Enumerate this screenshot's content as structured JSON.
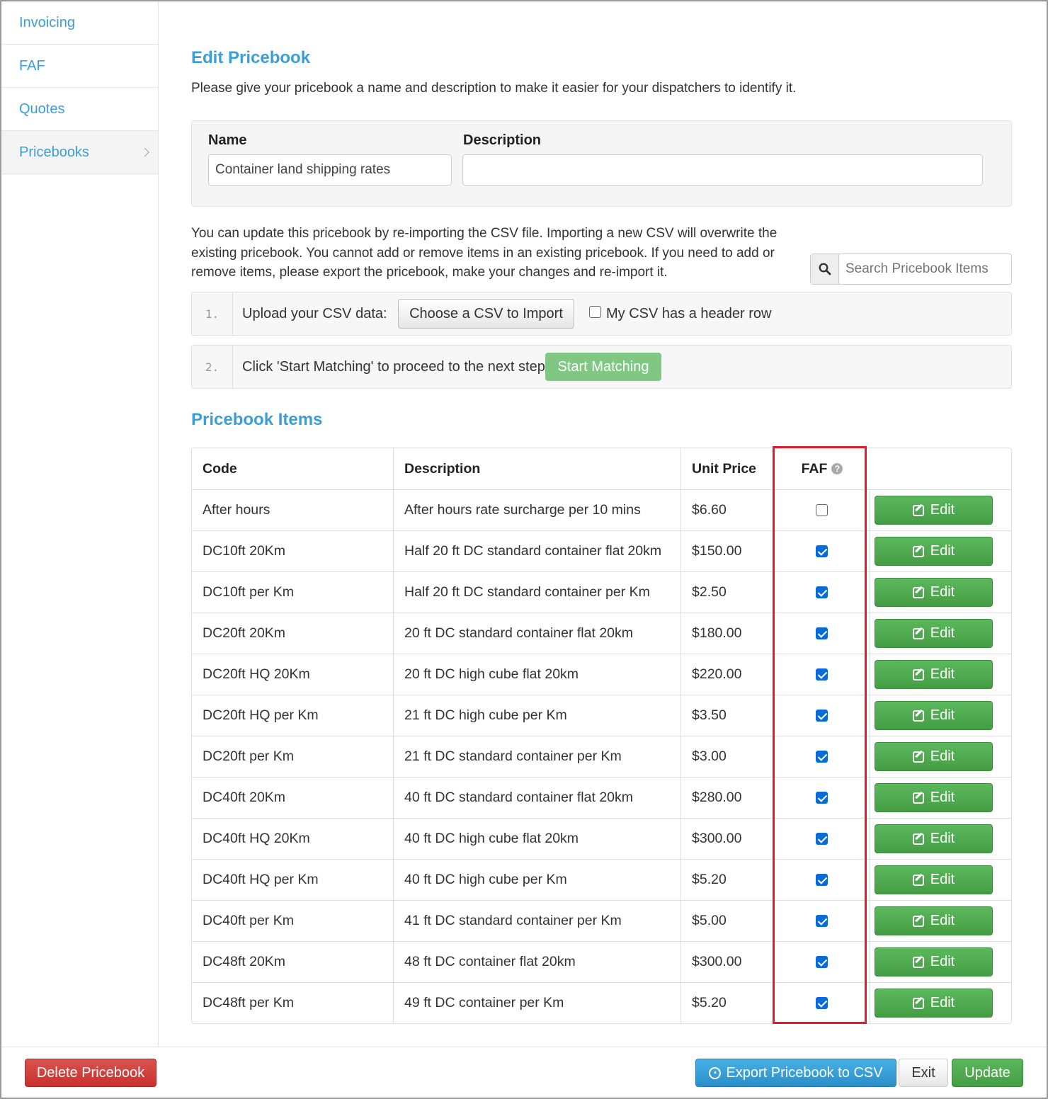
{
  "sidebar": {
    "items": [
      {
        "label": "Invoicing"
      },
      {
        "label": "FAF"
      },
      {
        "label": "Quotes"
      },
      {
        "label": "Pricebooks",
        "active": true
      }
    ]
  },
  "edit": {
    "title": "Edit Pricebook",
    "intro": "Please give your pricebook a name and description to make it easier for your dispatchers to identify it.",
    "name_label": "Name",
    "name_value": "Container land shipping rates",
    "description_label": "Description",
    "description_value": ""
  },
  "import": {
    "info": "You can update this pricebook by re-importing the CSV file. Importing a new CSV will overwrite the existing pricebook. You cannot add or remove items in an existing pricebook. If you need to add or remove items, please export the pricebook, make your changes and re-import it.",
    "search_placeholder": "Search Pricebook Items",
    "step1_num": "1.",
    "step1_text": "Upload your CSV data:",
    "step1_button": "Choose a CSV to Import",
    "header_row_label": "My CSV has a header row",
    "header_row_checked": false,
    "step2_num": "2.",
    "step2_text": "Click 'Start Matching' to proceed to the next step:",
    "step2_button": "Start Matching"
  },
  "items": {
    "title": "Pricebook Items",
    "columns": {
      "code": "Code",
      "description": "Description",
      "unit_price": "Unit Price",
      "faf": "FAF"
    },
    "edit_label": "Edit",
    "rows": [
      {
        "code": "After hours",
        "description": "After hours rate surcharge per 10 mins",
        "price": "$6.60",
        "faf": false
      },
      {
        "code": "DC10ft 20Km",
        "description": "Half 20 ft DC standard container flat 20km",
        "price": "$150.00",
        "faf": true
      },
      {
        "code": "DC10ft per Km",
        "description": "Half 20 ft DC standard container per Km",
        "price": "$2.50",
        "faf": true
      },
      {
        "code": "DC20ft 20Km",
        "description": "20 ft DC standard container flat 20km",
        "price": "$180.00",
        "faf": true
      },
      {
        "code": "DC20ft HQ 20Km",
        "description": "20 ft DC high cube flat 20km",
        "price": "$220.00",
        "faf": true
      },
      {
        "code": "DC20ft HQ per Km",
        "description": "21 ft DC high cube per Km",
        "price": "$3.50",
        "faf": true
      },
      {
        "code": "DC20ft per Km",
        "description": "21 ft DC standard container per Km",
        "price": "$3.00",
        "faf": true
      },
      {
        "code": "DC40ft 20Km",
        "description": "40 ft DC standard container flat 20km",
        "price": "$280.00",
        "faf": true
      },
      {
        "code": "DC40ft HQ 20Km",
        "description": "40 ft DC high cube flat 20km",
        "price": "$300.00",
        "faf": true
      },
      {
        "code": "DC40ft HQ per Km",
        "description": "40 ft DC high cube per Km",
        "price": "$5.20",
        "faf": true
      },
      {
        "code": "DC40ft per Km",
        "description": "41 ft DC standard container per Km",
        "price": "$5.00",
        "faf": true
      },
      {
        "code": "DC48ft 20Km",
        "description": "48 ft DC container flat 20km",
        "price": "$300.00",
        "faf": true
      },
      {
        "code": "DC48ft per Km",
        "description": "49 ft DC container per Km",
        "price": "$5.20",
        "faf": true
      }
    ]
  },
  "footer": {
    "delete_label": "Delete Pricebook",
    "export_label": "Export Pricebook to CSV",
    "exit_label": "Exit",
    "update_label": "Update"
  },
  "colors": {
    "accent": "#3a9fd6",
    "highlight": "#e11b2a",
    "success": "#5cb85c",
    "danger": "#d9534f"
  }
}
